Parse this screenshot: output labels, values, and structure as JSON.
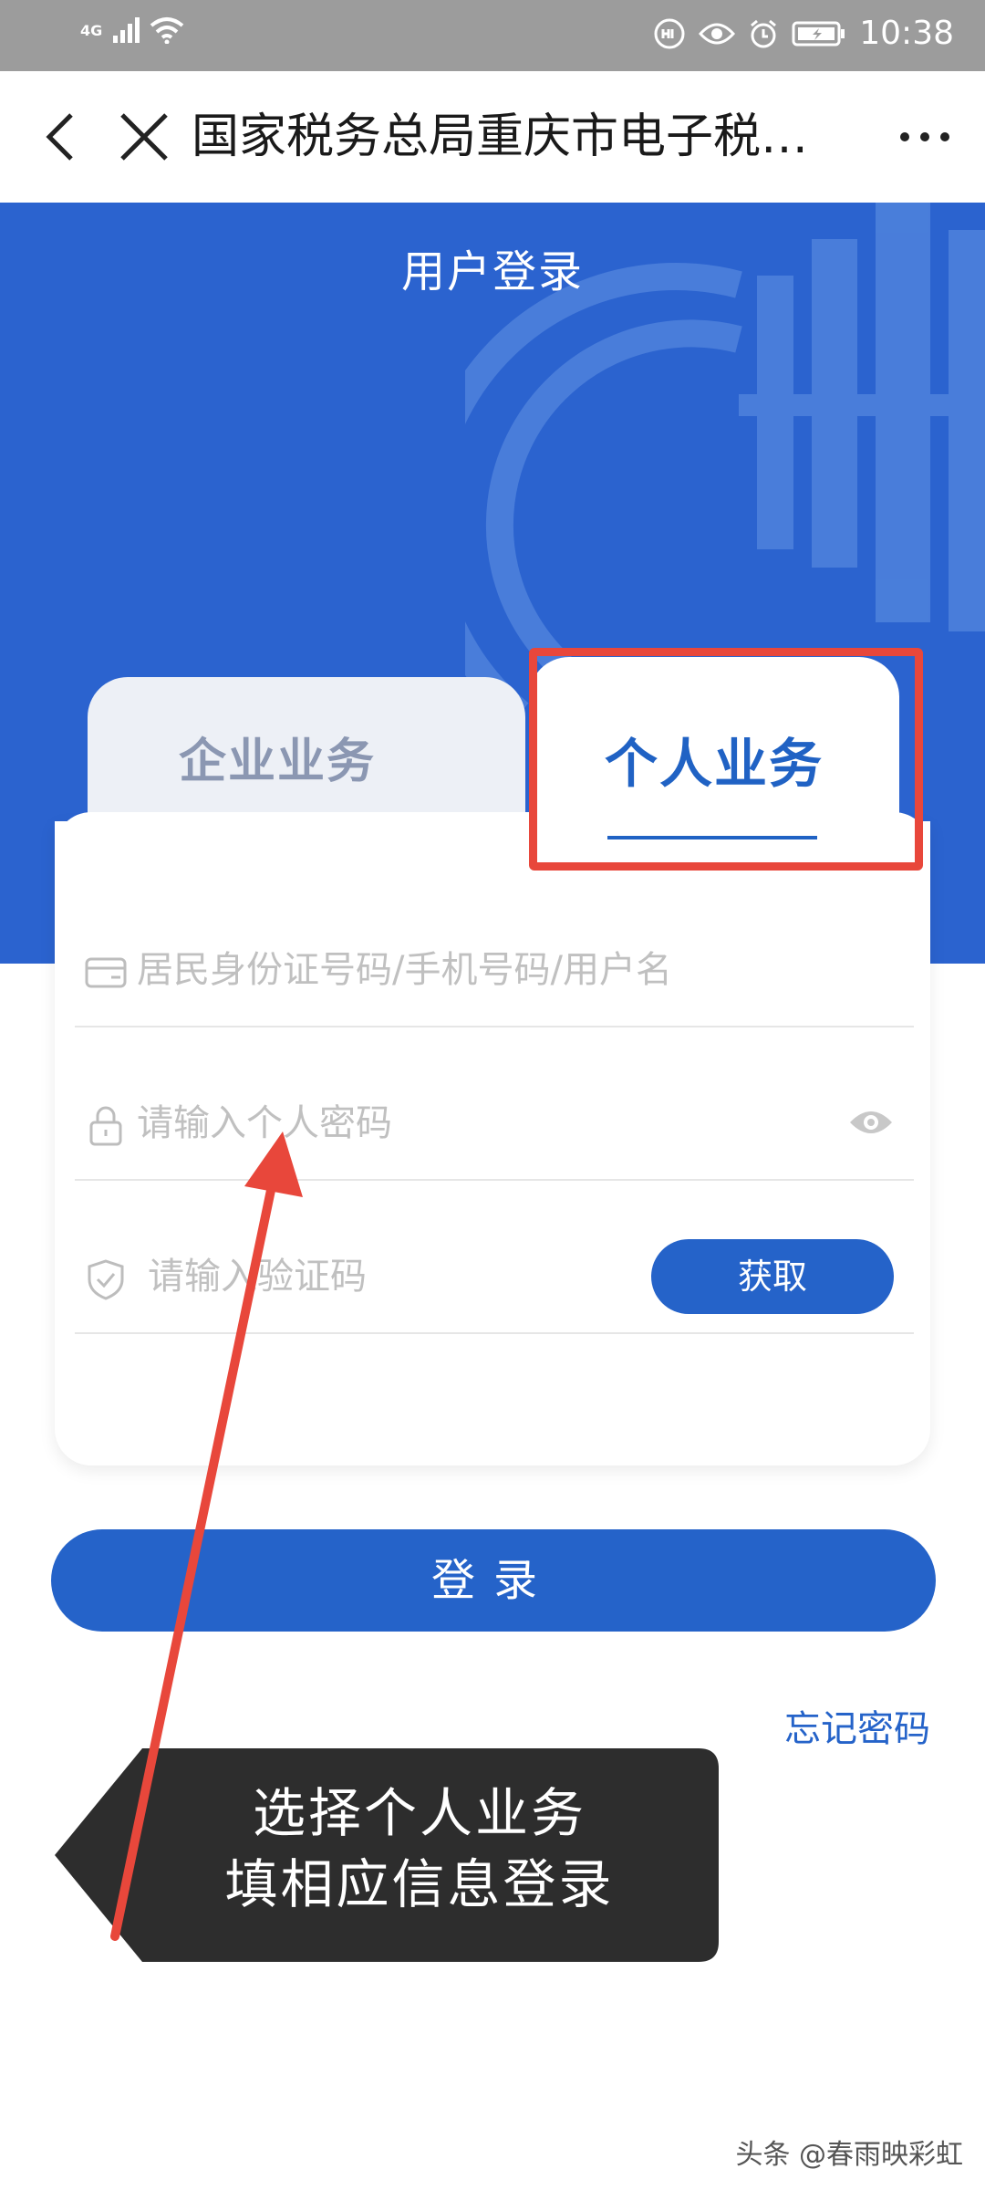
{
  "status_bar": {
    "network": "4G",
    "time": "10:38"
  },
  "nav": {
    "title": "国家税务总局重庆市电子税…"
  },
  "header": {
    "title": "用户登录"
  },
  "tabs": [
    {
      "label": "企业业务",
      "active": false
    },
    {
      "label": "个人业务",
      "active": true
    }
  ],
  "form": {
    "account_placeholder": "居民身份证号码/手机号码/用户名",
    "password_placeholder": "请输入个人密码",
    "code_placeholder": "请输入验证码",
    "get_code_label": "获取"
  },
  "login_label": "登录",
  "forgot_label": "忘记密码",
  "annotation": {
    "line1": "选择个人业务",
    "line2": "填相应信息登录"
  },
  "watermark": "头条 @春雨映彩虹",
  "colors": {
    "primary": "#2563c9",
    "header_bg": "#2b63cf",
    "highlight": "#e8473b"
  }
}
